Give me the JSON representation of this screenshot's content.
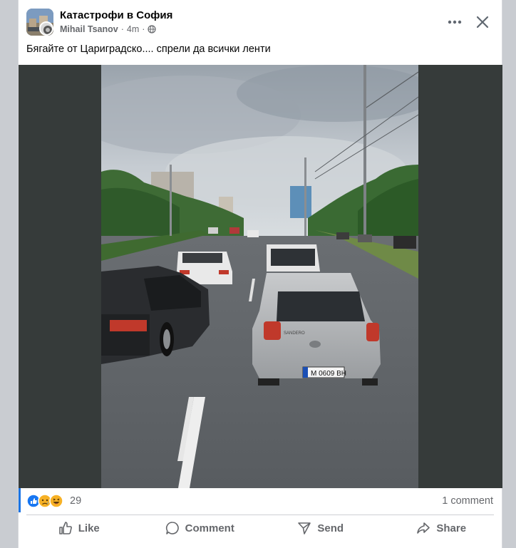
{
  "post": {
    "group_name": "Катастрофи в София",
    "author": "Mihail Tsanov",
    "time": "4m",
    "separator": "·",
    "privacy_icon": "globe-icon",
    "text": "Бягайте от Цариградско.... спрели да всички ленти"
  },
  "header": {
    "more_icon": "more-options-icon",
    "close_icon": "close-icon"
  },
  "photo": {
    "plate": "M 0609 BH",
    "car_model": "SANDERO"
  },
  "reactions": {
    "types": [
      "like",
      "sad",
      "haha"
    ],
    "count": "29",
    "comments": "1 comment"
  },
  "actions": {
    "like": "Like",
    "comment": "Comment",
    "send": "Send",
    "share": "Share"
  },
  "colors": {
    "accent": "#1b74e4",
    "text_secondary": "#65676b",
    "media_bg": "#363b3a"
  }
}
